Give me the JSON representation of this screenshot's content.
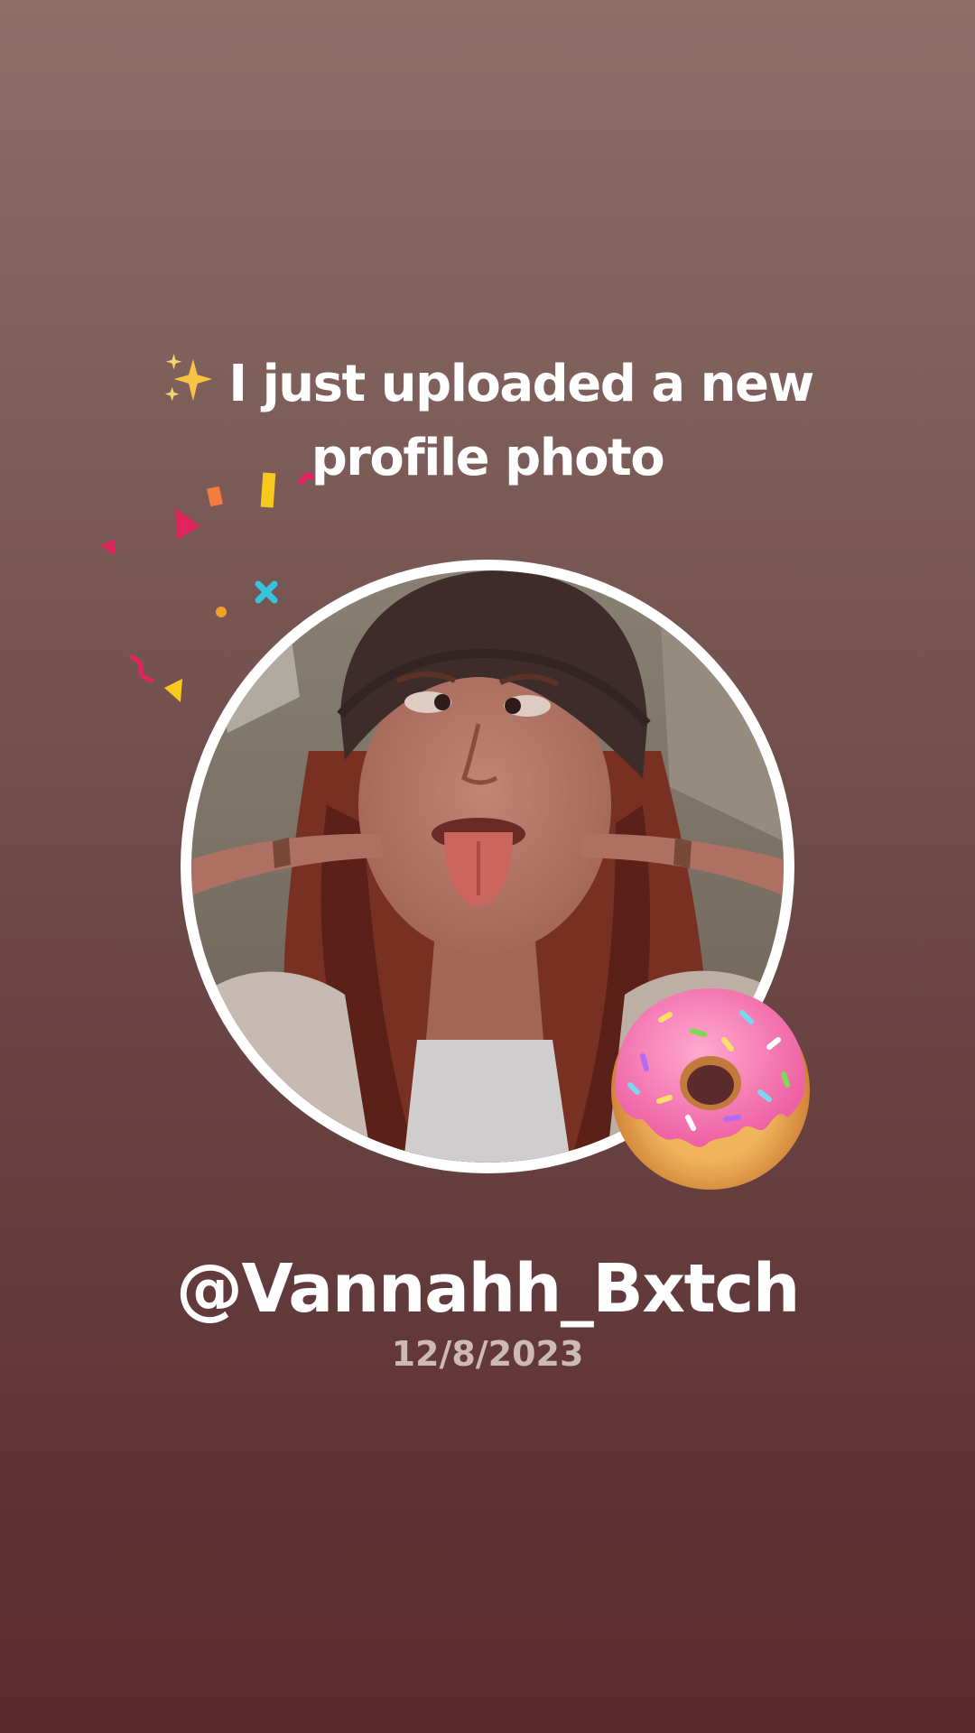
{
  "headline": {
    "icon": "sparkles-icon",
    "text": "I just uploaded a new profile photo"
  },
  "profile": {
    "photo": "profile-photo",
    "sticker": "donut-icon",
    "username": "@Vannahh_Bxtch",
    "date": "12/8/2023"
  },
  "colors": {
    "background_top": "#8c6e67",
    "background_bottom": "#5a2a2d",
    "ring": "#ffffff",
    "date_text": "#cdb9b7"
  }
}
